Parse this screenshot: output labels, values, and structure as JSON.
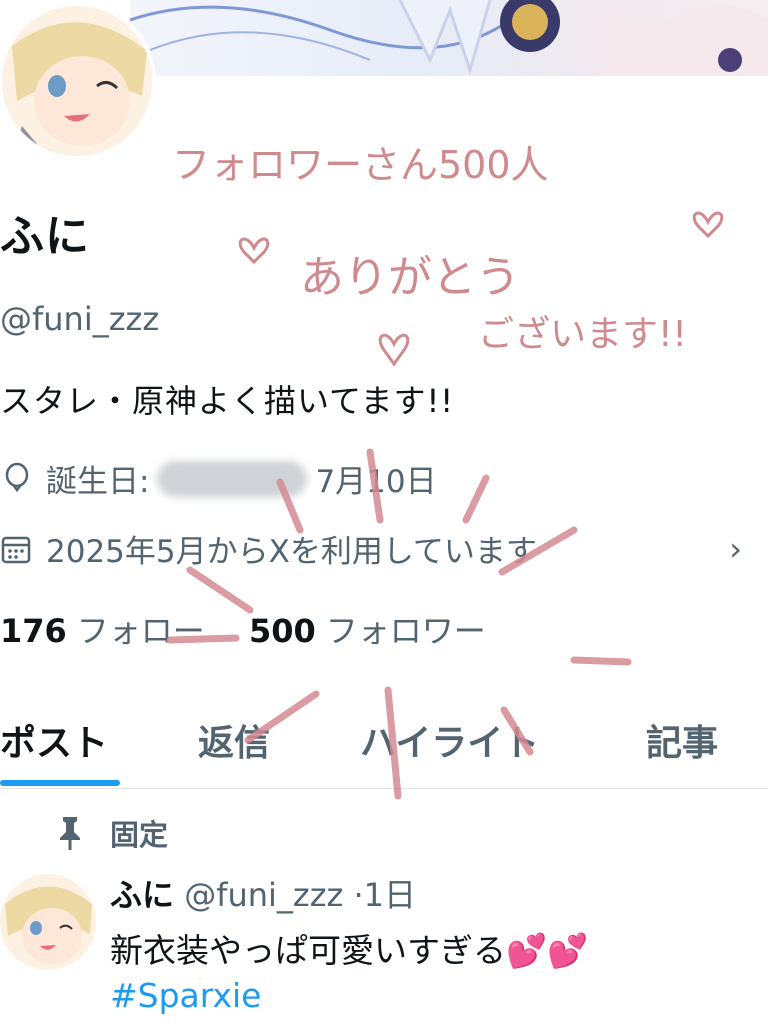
{
  "profile": {
    "display_name": "ふに",
    "handle": "@funi_zzz",
    "bio": "スタレ・原神よく描いてます!!",
    "birthday_label": "誕生日:",
    "birthday_visible": "7月10日",
    "joined": "2025年5月からXを利用しています",
    "following_count": "176",
    "following_label": "フォロー",
    "followers_count": "500",
    "followers_label": "フォロワー"
  },
  "tabs": [
    {
      "label": "ポスト",
      "active": true
    },
    {
      "label": "返信",
      "active": false
    },
    {
      "label": "ハイライト",
      "active": false
    },
    {
      "label": "記事",
      "active": false
    }
  ],
  "pinned_post": {
    "pinned_label": "固定",
    "author_name": "ふに",
    "author_handle": "@funi_zzz",
    "separator": "·",
    "time": "1日",
    "text": "新衣装やっぱ可愛いすぎる💕💕",
    "hashtag": "#Sparxie"
  },
  "handwritten_note": {
    "line1": "フォロワーさん500人",
    "line2": "ありがとう",
    "line3": "ございます!!"
  },
  "colors": {
    "accent": "#1d9bf0",
    "secondary_text": "#536471",
    "handwriting": "#cf8a8e"
  },
  "icons": {
    "birthday": "balloon-icon",
    "joined": "calendar-icon",
    "pinned": "pin-icon",
    "chevron": "chevron-right-icon"
  }
}
